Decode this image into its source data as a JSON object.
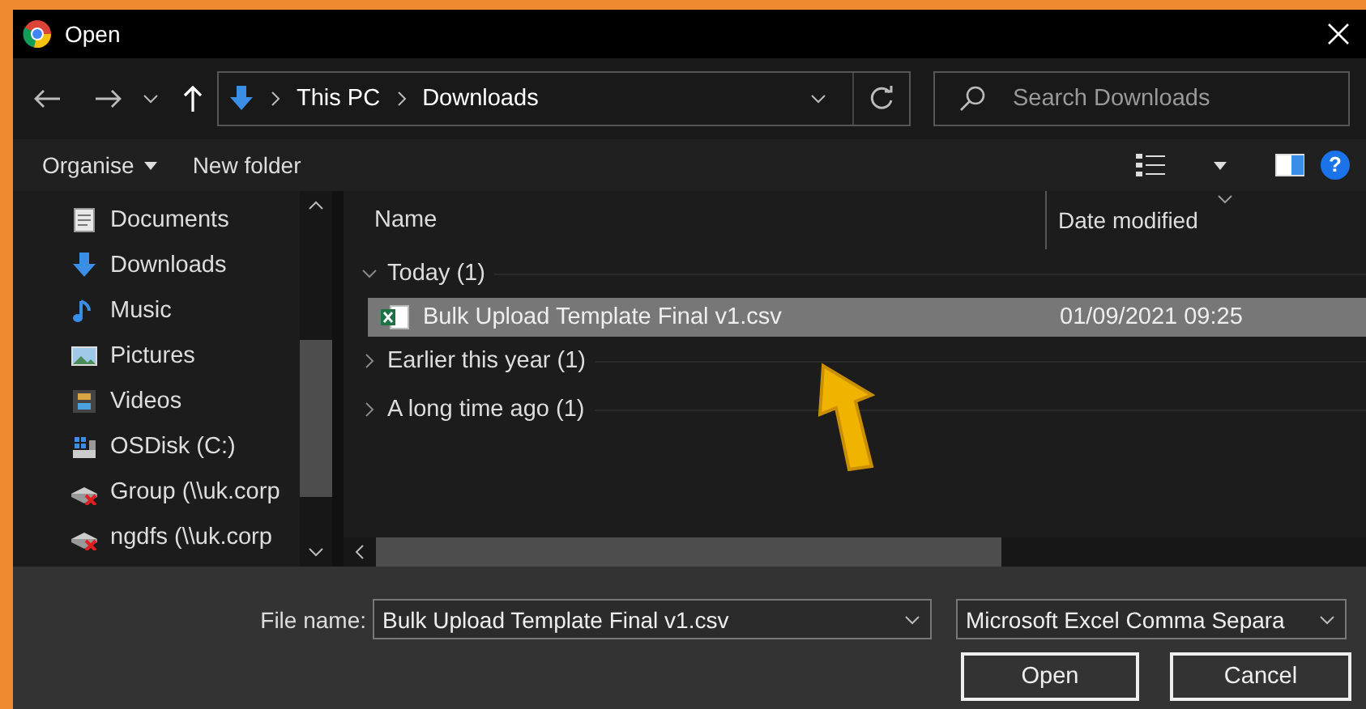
{
  "window": {
    "title": "Open"
  },
  "nav": {
    "path": [
      "This PC",
      "Downloads"
    ],
    "search": {
      "placeholder": "Search Downloads"
    }
  },
  "toolbar": {
    "organise": "Organise",
    "new_folder": "New folder",
    "help": "?"
  },
  "sidebar": {
    "items": [
      {
        "label": "Documents",
        "kind": "documents"
      },
      {
        "label": "Downloads",
        "kind": "downloads"
      },
      {
        "label": "Music",
        "kind": "music"
      },
      {
        "label": "Pictures",
        "kind": "pictures"
      },
      {
        "label": "Videos",
        "kind": "videos"
      },
      {
        "label": "OSDisk (C:)",
        "kind": "disk"
      },
      {
        "label": "Group (\\\\uk.corp",
        "kind": "network"
      },
      {
        "label": "ngdfs (\\\\uk.corp",
        "kind": "network"
      }
    ]
  },
  "table": {
    "columns": [
      "Name",
      "Date modified"
    ],
    "groups": [
      {
        "label": "Today (1)",
        "expanded": true,
        "files": [
          {
            "name": "Bulk Upload Template Final v1.csv",
            "date": "01/09/2021 09:25",
            "selected": true
          }
        ]
      },
      {
        "label": "Earlier this year (1)",
        "expanded": false
      },
      {
        "label": "A long time ago (1)",
        "expanded": false
      }
    ]
  },
  "footer": {
    "file_name_label": "File name:",
    "file_name": "Bulk Upload Template Final v1.csv",
    "file_type": "Microsoft Excel Comma Separa",
    "buttons": [
      "Open",
      "Cancel"
    ]
  }
}
